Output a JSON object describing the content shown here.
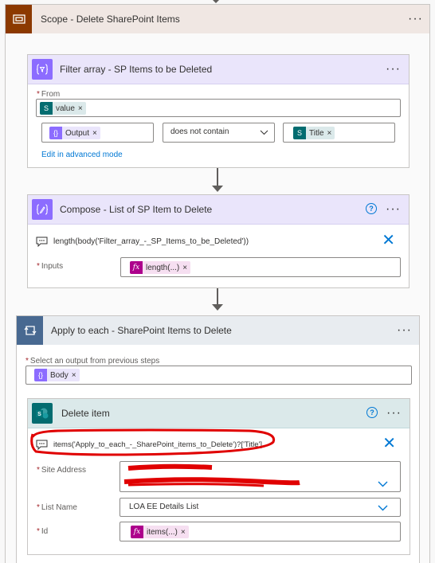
{
  "scope": {
    "title": "Scope - Delete SharePoint Items",
    "more_label": "···"
  },
  "filter": {
    "title": "Filter array - SP Items to be Deleted",
    "more_label": "···",
    "from_label": "From",
    "from_token": "value",
    "output_token": "Output",
    "operator": "does not contain",
    "title_token": "Title",
    "advanced_link": "Edit in advanced mode"
  },
  "compose": {
    "title": "Compose - List of SP Item to Delete",
    "more_label": "···",
    "help_label": "?",
    "comment": "length(body('Filter_array_-_SP_Items_to_be_Deleted'))",
    "inputs_label": "Inputs",
    "inputs_token": "length(...)"
  },
  "apply": {
    "title": "Apply to each - SharePoint Items to Delete",
    "more_label": "···",
    "select_label": "Select an output from previous steps",
    "body_token": "Body"
  },
  "delete": {
    "title": "Delete item",
    "more_label": "···",
    "help_label": "?",
    "comment": "items('Apply_to_each_-_SharePoint_items_to_Delete')?['Title']",
    "site_label": "Site Address",
    "list_label": "List Name",
    "list_value": "LOA EE Details List",
    "id_label": "Id",
    "id_token": "items(...)"
  },
  "token_remove": "×",
  "required_mark": "*",
  "colors": {
    "scope_header": "#f0e7e3",
    "scope_icon": "#8c3900",
    "data_op_header": "#eae5fb",
    "data_op_icon": "#8c6cff",
    "control_header": "#e8ecf0",
    "control_icon": "#486991",
    "sharepoint_header": "#dbe9ea",
    "sharepoint_icon": "#036c70",
    "expression_token": "#ad008c",
    "redaction": "#e00000"
  }
}
